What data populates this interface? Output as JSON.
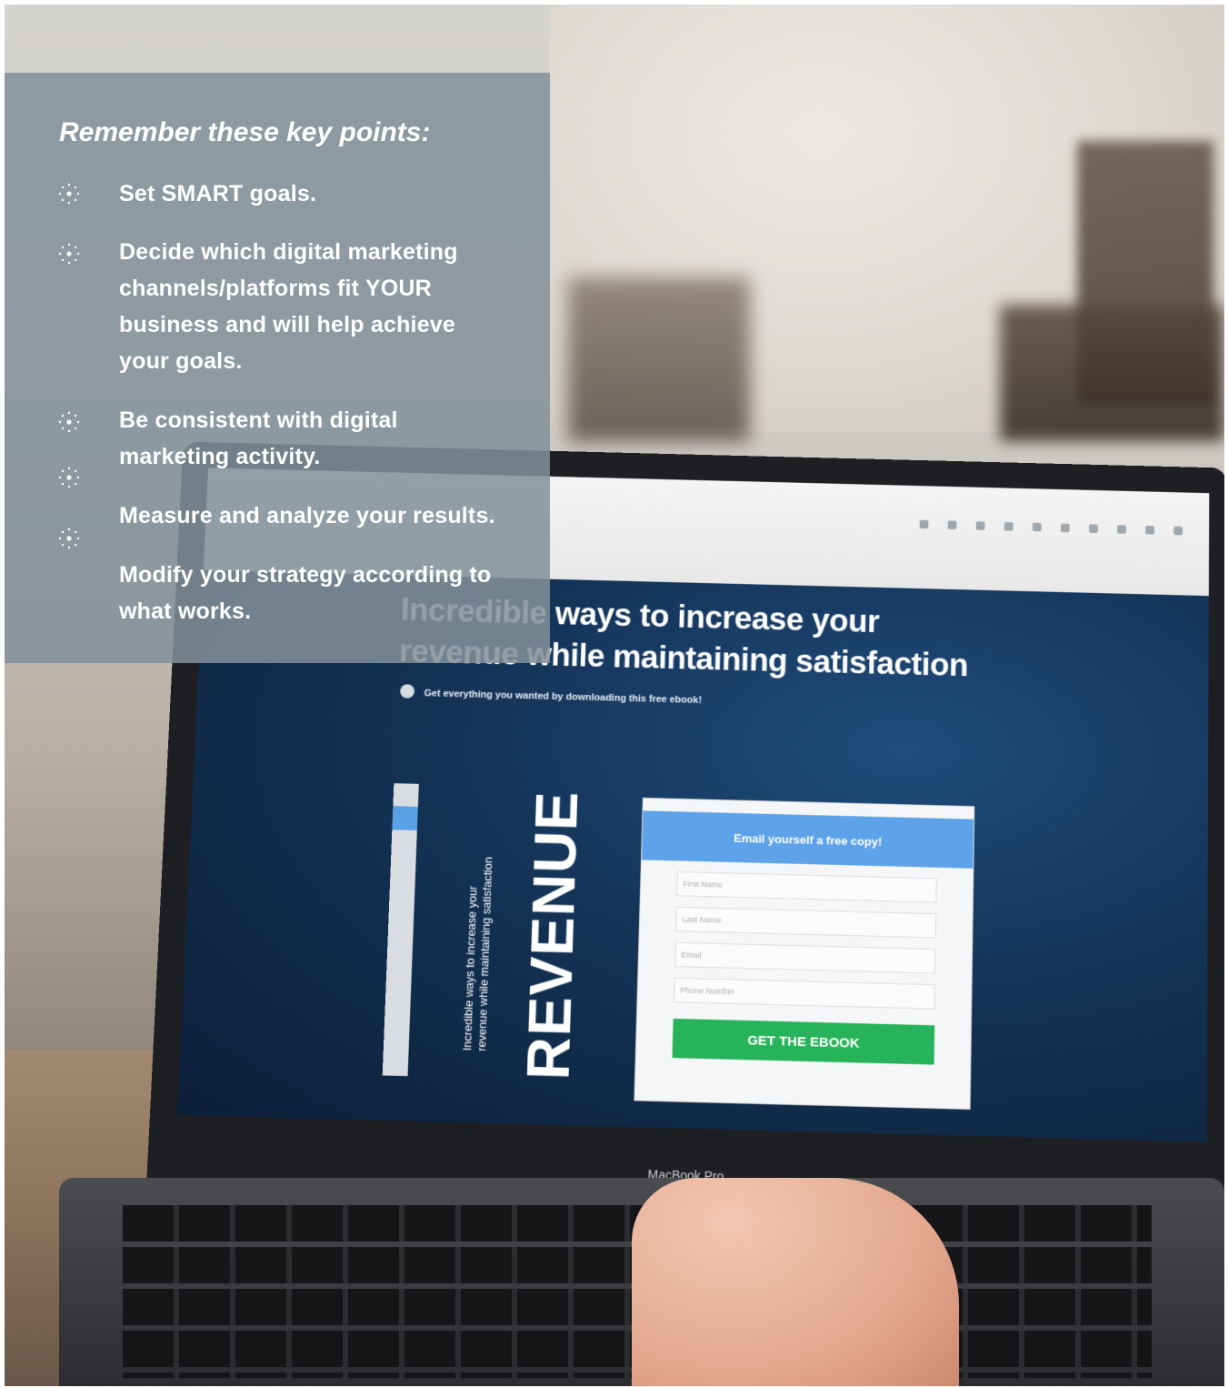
{
  "overlay": {
    "heading": "Remember these key points:",
    "bullet_icon": "dotted-sun-icon",
    "points": [
      "Set SMART goals.",
      "Decide which digital marketing channels/platforms fit YOUR business and will help achieve your goals.",
      "Be consistent with digital marketing activity.",
      "Measure and analyze your results.",
      "Modify your strategy according to what works."
    ]
  },
  "laptop": {
    "brand": "MacBook Pro",
    "screen": {
      "headline_line1": "Incredible ways to increase your",
      "headline_line2": "revenue while maintaining satisfaction",
      "subtext": "Get everything you wanted by downloading this free ebook!",
      "ebook_title_line1": "Incredible ways to increase your",
      "ebook_title_line2": "revenue while maintaining satisfaction",
      "ebook_cover_word": "REVENUE",
      "form": {
        "heading": "Email yourself a free copy!",
        "fields": [
          "First Name",
          "Last Name",
          "Email",
          "Phone Number"
        ],
        "button": "GET THE EBOOK"
      }
    }
  },
  "colors": {
    "overlay_panel": "#82909a",
    "form_header": "#5ea3ea",
    "form_button": "#27b35a",
    "page_background": "#143356"
  }
}
